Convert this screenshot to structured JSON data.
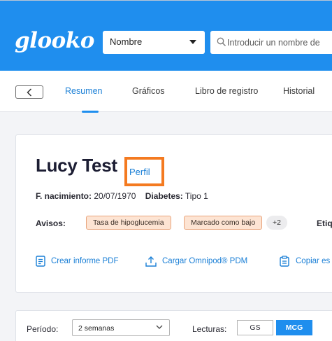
{
  "header": {
    "logo_text": "glooko",
    "search_type": {
      "selected": "Nombre"
    },
    "search": {
      "placeholder": "Introducir un nombre de"
    }
  },
  "tabs": {
    "back_icon": "chevron-left-icon",
    "items": [
      {
        "label": "Resumen",
        "active": true
      },
      {
        "label": "Gráficos",
        "active": false
      },
      {
        "label": "Libro de registro",
        "active": false
      },
      {
        "label": "Historial",
        "active": false
      }
    ]
  },
  "patient": {
    "name": "Lucy Test",
    "profile_link": "Perfil",
    "dob_label": "F. nacimiento:",
    "dob_value": "20/07/1970",
    "diabetes_label": "Diabetes:",
    "diabetes_value": "Tipo 1",
    "alerts_label": "Avisos:",
    "alerts": [
      "Tasa de hipoglucemia",
      "Marcado como bajo"
    ],
    "alerts_more": "+2",
    "tags_label": "Etique"
  },
  "actions": [
    {
      "label": "Crear informe PDF",
      "icon": "document-icon"
    },
    {
      "label": "Cargar Omnipod® PDM",
      "icon": "upload-icon"
    },
    {
      "label": "Copiar es",
      "icon": "clipboard-icon"
    }
  ],
  "filters": {
    "period_label": "Período:",
    "period_value": "2 semanas",
    "readings_label": "Lecturas:",
    "readings_options": [
      "GS",
      "MCG"
    ],
    "readings_selected": "MCG"
  },
  "colors": {
    "brand_blue": "#1f8eee",
    "link_blue": "#1a7fd6",
    "highlight_orange": "#f47a20",
    "alert_badge_bg": "#fde4d3",
    "alert_badge_border": "#e8a47c"
  }
}
